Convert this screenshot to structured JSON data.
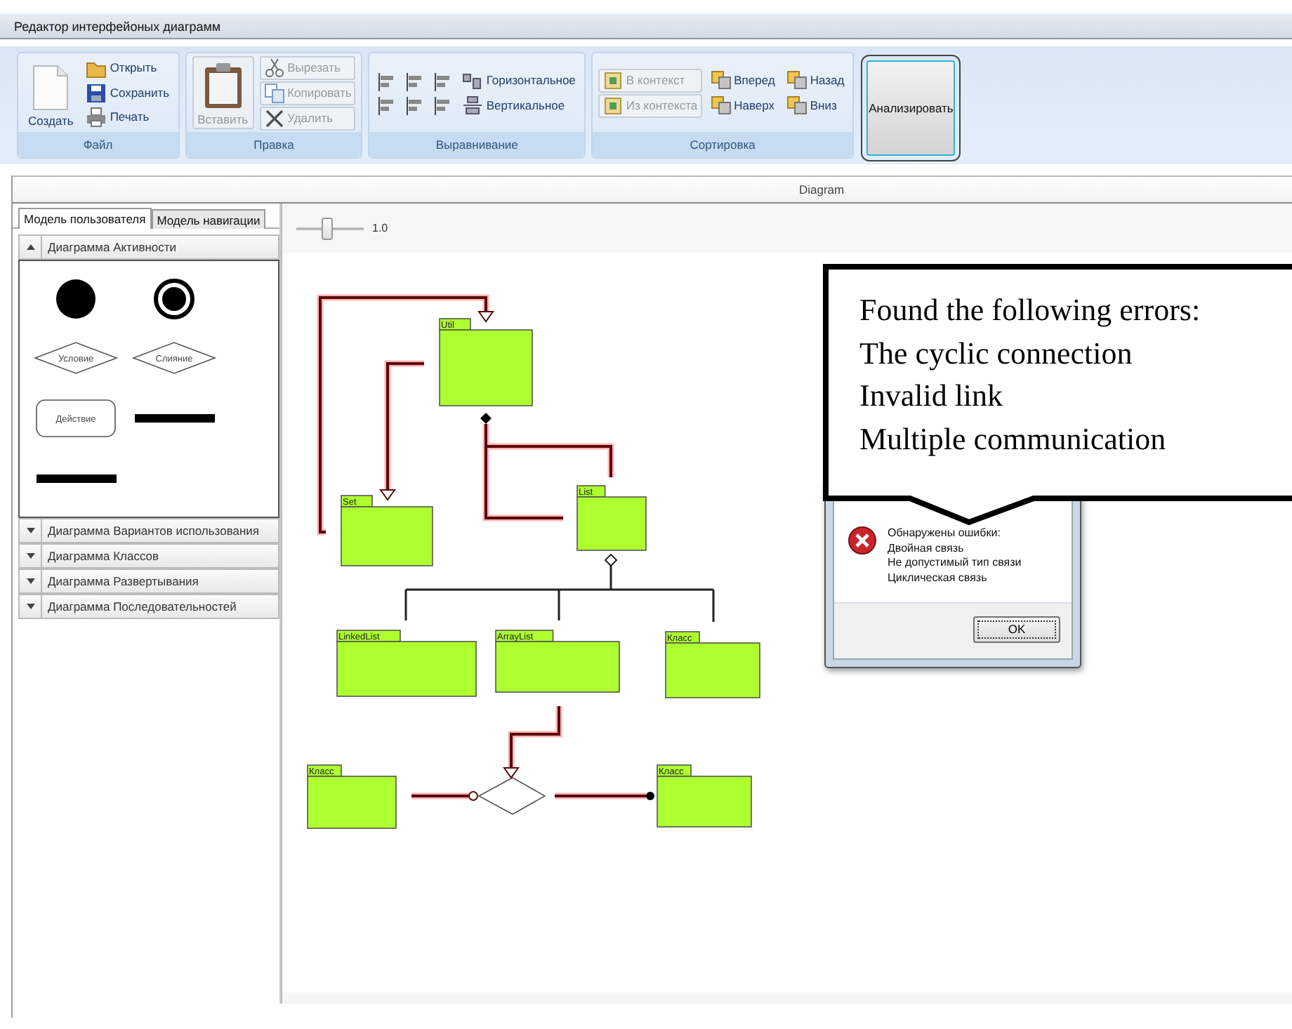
{
  "window": {
    "title": "Редактор интерфейоных диаграмм"
  },
  "ribbon": {
    "groups": [
      {
        "label": "Файл",
        "columns": [
          [
            {
              "kind": "large",
              "label": "Создать",
              "disabled": false
            }
          ],
          [
            {
              "kind": "small",
              "label": "Открыть",
              "disabled": false
            },
            {
              "kind": "small",
              "label": "Сохранить",
              "disabled": false
            },
            {
              "kind": "small",
              "label": "Печать",
              "disabled": false
            }
          ]
        ]
      },
      {
        "label": "Правка",
        "columns": [
          [
            {
              "kind": "large",
              "label": "Вставить",
              "disabled": true
            }
          ],
          [
            {
              "kind": "boxed",
              "label": "Вырезать",
              "disabled": true
            },
            {
              "kind": "boxed",
              "label": "Копировать",
              "disabled": true
            },
            {
              "kind": "boxed",
              "label": "Удалить",
              "disabled": true
            }
          ]
        ]
      },
      {
        "label": "Выравнивание",
        "columns": [
          [
            {
              "kind": "icon",
              "disabled": false
            },
            {
              "kind": "icon",
              "disabled": false
            }
          ],
          [
            {
              "kind": "icon",
              "disabled": false
            },
            {
              "kind": "icon",
              "disabled": false
            }
          ],
          [
            {
              "kind": "icon",
              "disabled": false
            },
            {
              "kind": "icon",
              "disabled": false
            }
          ],
          [
            {
              "kind": "small",
              "label": "Горизонтальное",
              "disabled": false
            },
            {
              "kind": "small",
              "label": "Вертикальное",
              "disabled": false
            }
          ]
        ]
      },
      {
        "label": "Сортировка",
        "columns": [
          [
            {
              "kind": "boxed",
              "label": "В контекст",
              "disabled": true
            },
            {
              "kind": "boxed",
              "label": "Из контекста",
              "disabled": true
            }
          ],
          [
            {
              "kind": "small",
              "label": "Вперед",
              "disabled": false
            },
            {
              "kind": "small",
              "label": "Наверх",
              "disabled": false
            }
          ],
          [
            {
              "kind": "small",
              "label": "Назад",
              "disabled": false
            },
            {
              "kind": "small",
              "label": "Вниз",
              "disabled": false
            }
          ]
        ]
      }
    ],
    "analyze_button": "Анализировать"
  },
  "document": {
    "title": "Diagram"
  },
  "tabs": [
    {
      "label": "Модель пользователя",
      "selected": true
    },
    {
      "label": "Модель навигации",
      "selected": false
    }
  ],
  "toolbox": {
    "sections": [
      {
        "label": "Диаграмма Активности",
        "expanded": true,
        "items": [
          {
            "kind": "initial"
          },
          {
            "kind": "final"
          },
          {
            "kind": "decision",
            "label": "Условие"
          },
          {
            "kind": "decision",
            "label": "Слияние"
          },
          {
            "kind": "action",
            "label": "Действие"
          },
          {
            "kind": "bar"
          },
          {
            "kind": "bar"
          }
        ]
      },
      {
        "label": "Диаграмма Вариантов использования",
        "expanded": false
      },
      {
        "label": "Диаграмма Классов",
        "expanded": false
      },
      {
        "label": "Диаграмма Развертывания",
        "expanded": false
      },
      {
        "label": "Диаграмма Последовательностей",
        "expanded": false
      }
    ]
  },
  "zoom": {
    "level": 0.45,
    "reading": "1.0"
  },
  "diagram": {
    "nodes": [
      {
        "kind": "package",
        "label": "Util"
      },
      {
        "kind": "package",
        "label": "Set"
      },
      {
        "kind": "package",
        "label": "List"
      },
      {
        "kind": "package",
        "label": "LinkedList"
      },
      {
        "kind": "package",
        "label": "ArrayList"
      },
      {
        "kind": "package",
        "label": "Класс"
      },
      {
        "kind": "package",
        "label": "Класс"
      },
      {
        "kind": "package",
        "label": "Класс"
      },
      {
        "kind": "decision"
      }
    ],
    "connections": [
      {
        "kind": "generalization",
        "highlighted": true
      },
      {
        "kind": "generalization",
        "highlighted": true
      },
      {
        "kind": "composition",
        "highlighted": true
      },
      {
        "kind": "aggregation",
        "highlighted": false
      },
      {
        "kind": "generalization",
        "highlighted": true
      },
      {
        "kind": "aggregation",
        "highlighted": true
      },
      {
        "kind": "composition",
        "highlighted": true
      }
    ]
  },
  "callout": {
    "lines": [
      "Found the following errors:",
      "The cyclic connection",
      "Invalid link",
      "Multiple communication"
    ]
  },
  "dialog": {
    "lines": [
      "Обнаружены ошибки:",
      "Двойная связь",
      "Не допустимый тип связи",
      "Циклическая связь"
    ],
    "button": "OK"
  }
}
